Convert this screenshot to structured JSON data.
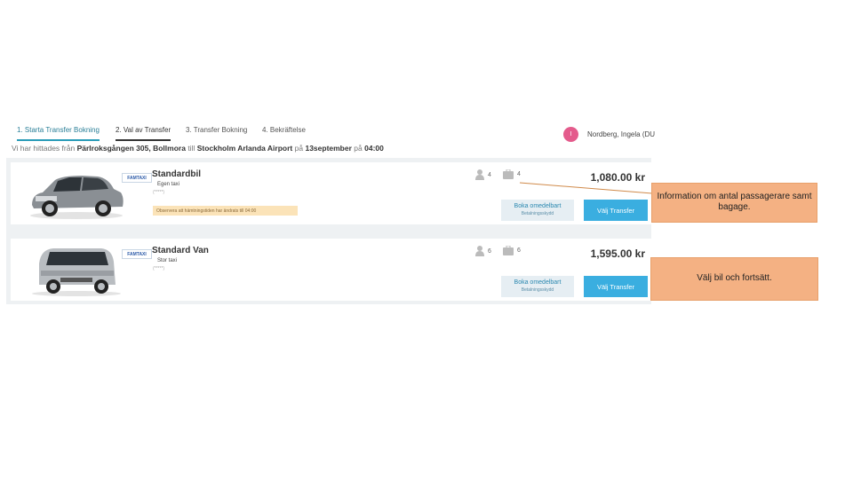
{
  "steps": [
    {
      "label": "1. Starta Transfer Bokning"
    },
    {
      "label": "2. Val av Transfer"
    },
    {
      "label": "3. Transfer Bokning"
    },
    {
      "label": "4. Bekräftelse"
    }
  ],
  "user": {
    "initial": "I",
    "name": "Nordberg, Ingela (DU"
  },
  "route": {
    "prefix": "Vi har hittades från",
    "from": "Pärlroksgången 305, Bollmora",
    "to_word": "till",
    "to": "Stockholm Arlanda Airport",
    "date_word": "på",
    "date": "13september",
    "time_word": "på",
    "time": "04:00"
  },
  "cars": [
    {
      "type": "Standardbil",
      "logo": "FAMTAXI",
      "company": "Egen taxi",
      "stars": "(*****)",
      "notice": "Observera att hämtningstiden har ändrats till 04:00",
      "passengers": "4",
      "bags": "4",
      "price": "1,080.00 kr",
      "book_later": "Boka omedelbart",
      "book_later_sub": "Betalningsskydd",
      "select": "Välj Transfer"
    },
    {
      "type": "Standard Van",
      "logo": "FAMTAXI",
      "company": "Stor taxi",
      "stars": "(*****)",
      "notice": "",
      "passengers": "6",
      "bags": "6",
      "price": "1,595.00 kr",
      "book_later": "Boka omedelbart",
      "book_later_sub": "Betalningsskydd",
      "select": "Välj Transfer"
    }
  ],
  "callouts": {
    "info": "Information om antal passagerare samt bagage.",
    "choose": "Välj bil och fortsätt."
  },
  "colors": {
    "accent": "#3aaee0",
    "callout": "#f4b183",
    "avatar": "#e45b8c",
    "notice": "#fbe3b8"
  }
}
